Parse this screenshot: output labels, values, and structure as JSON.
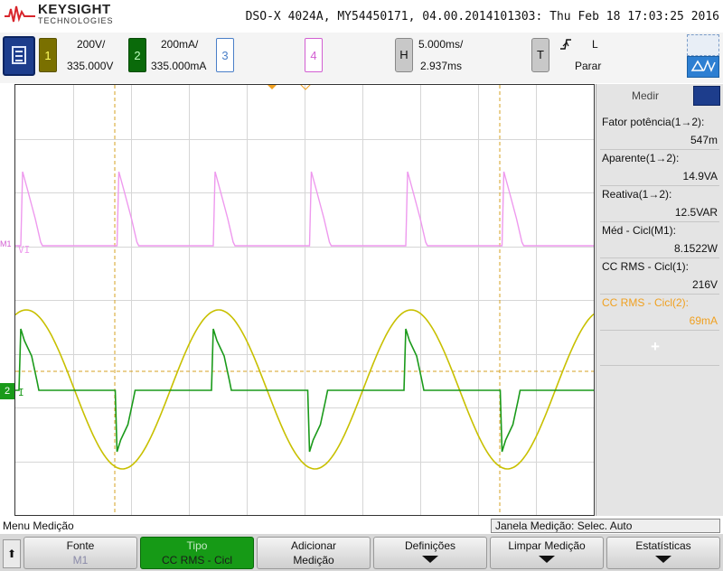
{
  "header": {
    "brand": "KEYSIGHT",
    "brand_sub": "TECHNOLOGIES",
    "instrument_title": "DSO-X 4024A, MY54450171, 04.00.2014101303: Thu Feb 18 17:03:25 2016"
  },
  "channels": {
    "ch1": {
      "number": "1",
      "scale": "200V/",
      "offset": "335.000V",
      "color": "#c8c000"
    },
    "ch2": {
      "number": "2",
      "scale": "200mA/",
      "offset": "335.000mA",
      "color": "#1a9a1a"
    },
    "ch3": {
      "number": "3",
      "color": "#4a7fc8"
    },
    "ch4": {
      "number": "4",
      "color": "#d25fd2"
    }
  },
  "timebase": {
    "key": "H",
    "scale": "5.000ms/",
    "delay": "2.937ms"
  },
  "trigger": {
    "key": "T",
    "edge_icon": "rising-edge-icon",
    "mode": "L",
    "state": "Parar"
  },
  "plot": {
    "labels": {
      "math": "VI",
      "ch2_label": "I",
      "ch2_marker": "2"
    }
  },
  "side_panel": {
    "tab_label": "Medir",
    "measurements": [
      {
        "label": "Fator potência(1→2):",
        "value": "547m",
        "highlight": false
      },
      {
        "label": "Aparente(1→2):",
        "value": "14.9VA",
        "highlight": false
      },
      {
        "label": "Reativa(1→2):",
        "value": "12.5VAR",
        "highlight": false
      },
      {
        "label": "Méd - Cicl(M1):",
        "value": "8.1522W",
        "highlight": false
      },
      {
        "label": "CC RMS - Cicl(1):",
        "value": "216V",
        "highlight": false
      },
      {
        "label": "CC RMS - Cicl(2):",
        "value": "69mA",
        "highlight": true
      }
    ],
    "add_symbol": "+",
    "highlight_color": "#f0a020"
  },
  "status": {
    "menu_name": "Menu Medição",
    "window_info": "Janela Medição: Selec. Auto"
  },
  "softkeys": {
    "home_symbol": "⬆",
    "source": {
      "label": "Fonte",
      "value": "M1"
    },
    "type": {
      "label": "Tipo",
      "value": "CC RMS - Cicl"
    },
    "add": {
      "label": "Adicionar",
      "label2": "Medição"
    },
    "settings": {
      "label": "Definições"
    },
    "clear": {
      "label": "Limpar Medição"
    },
    "stats": {
      "label": "Estatísticas"
    }
  }
}
